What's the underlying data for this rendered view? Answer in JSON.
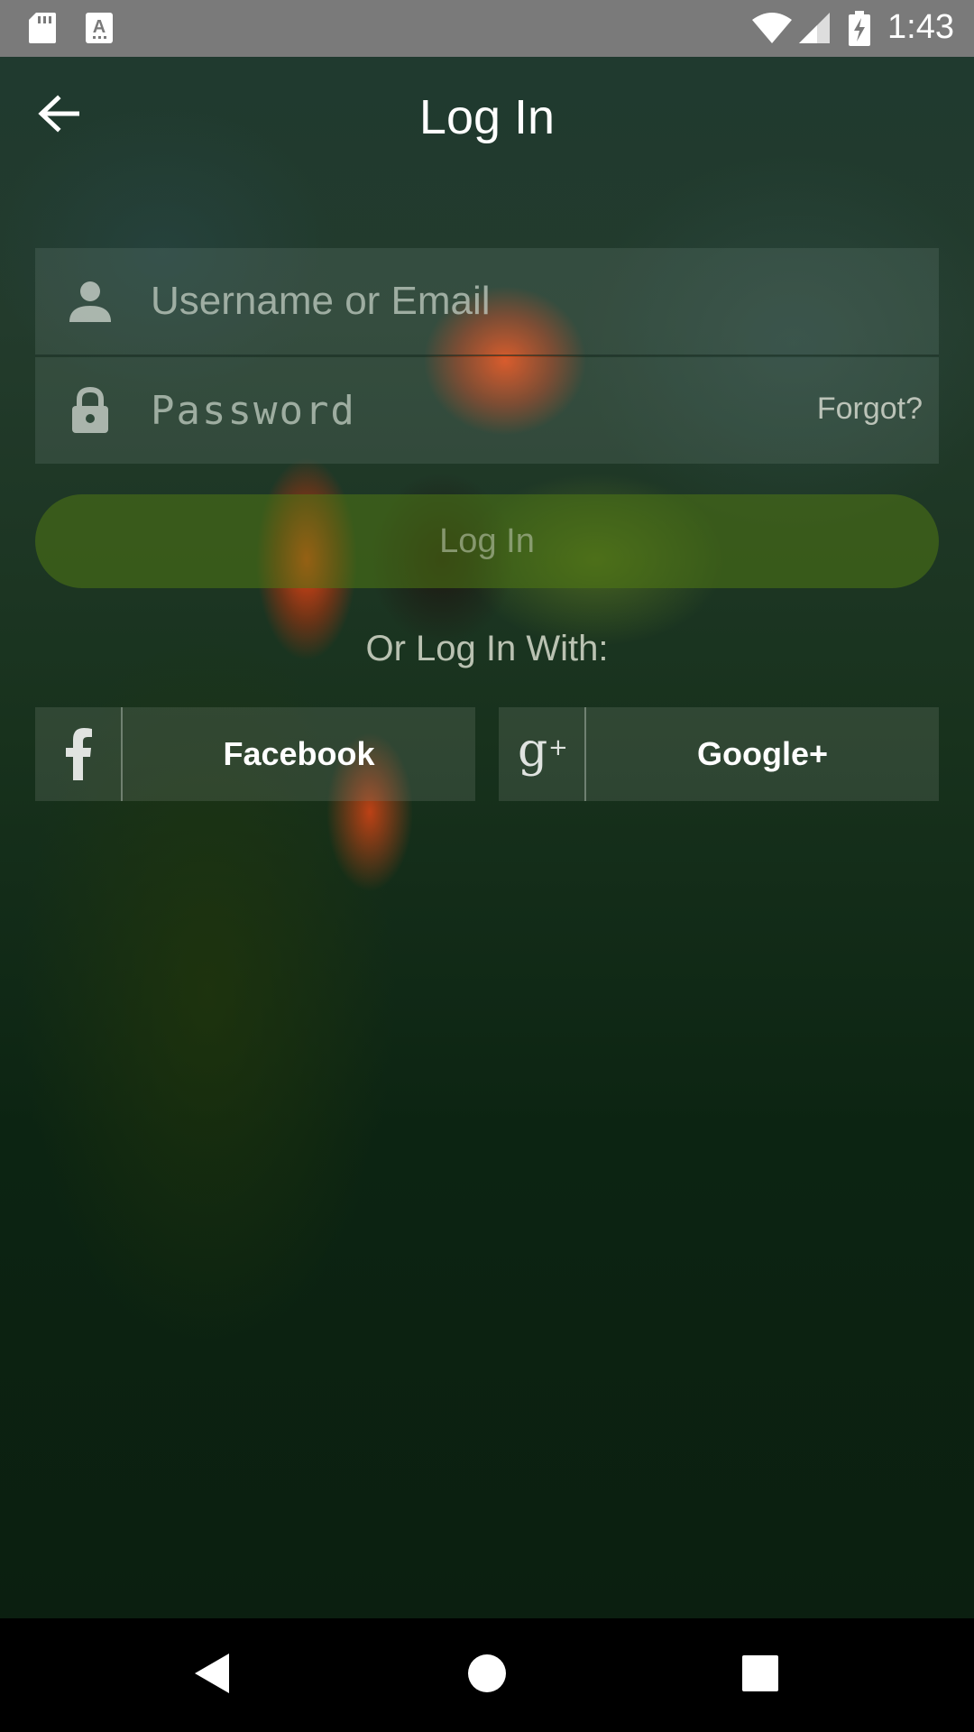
{
  "status_bar": {
    "time": "1:43",
    "left_icons": [
      "sd-card-icon",
      "keyboard-a-icon"
    ],
    "right_icons": [
      "wifi-icon",
      "signal-icon",
      "battery-charging-icon"
    ]
  },
  "toolbar": {
    "title": "Log In",
    "back_icon": "arrow-left-icon"
  },
  "form": {
    "username": {
      "placeholder": "Username or Email",
      "value": "",
      "icon": "person-icon"
    },
    "password": {
      "placeholder": "Password",
      "value": "",
      "icon": "lock-icon",
      "forgot_label": "Forgot?"
    },
    "login_button": "Log In"
  },
  "social": {
    "divider_text": "Or Log In With:",
    "facebook": {
      "label": "Facebook",
      "icon": "facebook-icon"
    },
    "google": {
      "label": "Google+",
      "icon": "google-plus-icon"
    }
  },
  "nav_bar": {
    "icons": [
      "back-triangle-icon",
      "home-circle-icon",
      "recents-square-icon"
    ]
  },
  "colors": {
    "status_bar": "#7a7a7a",
    "login_button": "#4f7814",
    "nav_bar": "#000000"
  }
}
